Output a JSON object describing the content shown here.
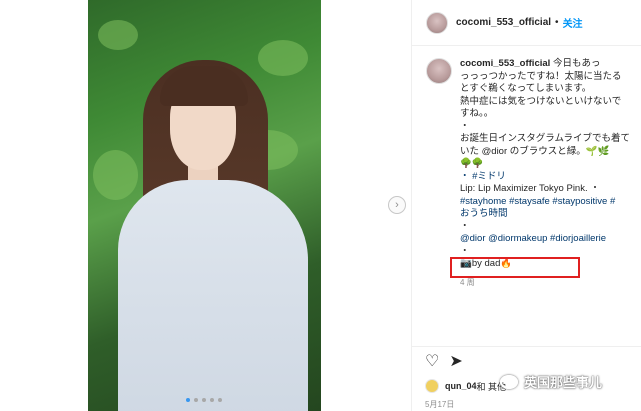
{
  "post": {
    "username": "cocomi_553_official",
    "separator": "•",
    "follow_label": "关注"
  },
  "caption": {
    "username": "cocomi_553_official",
    "lines": [
      "今日もあっ",
      "っっっつかったですね！太陽に当たる",
      "とすぐ鵜くなってしまいます。",
      "熱中症には気をつけないといけないで",
      "すね。。",
      "・",
      "お誕生日インスタグラムライブでも着て",
      "いた @dior のブラウスと緑。🌱🌿",
      "🌳🌳",
      "・ #ミドリ",
      "Lip: Lip Maximizer Tokyo Pink. ・",
      "#stayhome #staysafe #staypositive #",
      "おうち時間",
      "・",
      "@dior @diormakeup #diorjoaillerie",
      "・",
      "📷by dad🔥"
    ],
    "time": "4 周"
  },
  "actions": {
    "like_icon": "heart-icon",
    "share_icon": "send-icon"
  },
  "likes": {
    "user": "qun_04",
    "rest": " 和 其他"
  },
  "date": "5月17日",
  "watermark": "英国那些事儿",
  "carousel": {
    "count": 5,
    "active": 0
  }
}
